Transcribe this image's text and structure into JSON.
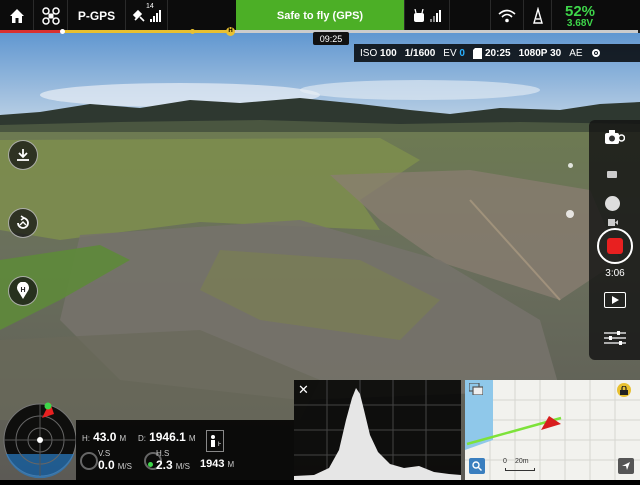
{
  "top_bar": {
    "flight_mode": "P-GPS",
    "satellite_count": "14",
    "status_text": "Safe to fly (GPS)",
    "battery_percent": "52%",
    "battery_voltage": "3.68V"
  },
  "flight_time": "09:25",
  "camera_info": {
    "iso_label": "ISO",
    "iso_value": "100",
    "shutter": "1/1600",
    "ev_label": "EV",
    "ev_value": "0",
    "remaining": "20:25",
    "video_format": "1080P 30",
    "exposure_mode": "AE"
  },
  "record_time": "3:06",
  "telemetry": {
    "height_label": "H:",
    "height_value": "43.0",
    "height_unit": "M",
    "distance_label": "D:",
    "distance_value": "1946.1",
    "distance_unit": "M",
    "vs_label": "V.S",
    "vs_value": "0.0",
    "vs_unit": "M/S",
    "hs_label": "H.S",
    "hs_value": "2.3",
    "hs_unit": "M/S",
    "home_distance": "1943",
    "home_unit": "M"
  },
  "map": {
    "scale_zero": "0",
    "scale_label": "20m"
  },
  "colors": {
    "safe_green": "#4caf26",
    "battery_green": "#3ed64a",
    "record_red": "#e82020",
    "ev_blue": "#2ab0ff"
  }
}
